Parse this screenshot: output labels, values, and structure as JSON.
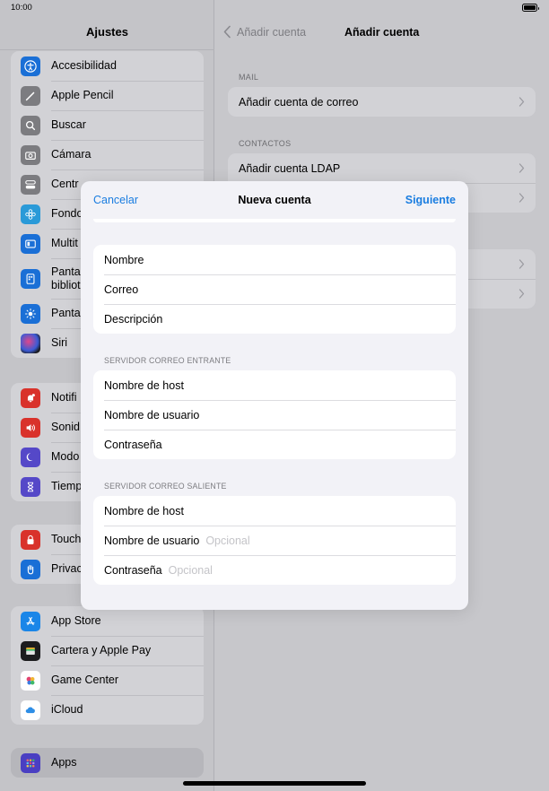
{
  "status": {
    "time": "10:00"
  },
  "sidebar": {
    "title": "Ajustes",
    "groups": [
      {
        "items": [
          {
            "label": "Accesibilidad",
            "icon": "accessibility-icon",
            "color": "#1a6fd6"
          },
          {
            "label": "Apple Pencil",
            "icon": "pencil-icon",
            "color": "#7c7c80"
          },
          {
            "label": "Buscar",
            "icon": "search-icon",
            "color": "#7c7c80"
          },
          {
            "label": "Cámara",
            "icon": "camera-icon",
            "color": "#7c7c80"
          },
          {
            "label": "Centr",
            "icon": "control-center-icon",
            "color": "#7c7c80"
          },
          {
            "label": "Fondo",
            "icon": "wallpaper-icon",
            "color": "#2a9ad8"
          },
          {
            "label": "Multit",
            "icon": "multitasking-icon",
            "color": "#1a6fd6"
          },
          {
            "label": "Panta\nbibliot",
            "icon": "home-screen-icon",
            "color": "#1a6fd6"
          },
          {
            "label": "Panta",
            "icon": "brightness-icon",
            "color": "#1a6fd6"
          },
          {
            "label": "Siri",
            "icon": "siri-icon",
            "color": "#222222"
          }
        ]
      },
      {
        "items": [
          {
            "label": "Notifi",
            "icon": "notifications-icon",
            "color": "#d9322b"
          },
          {
            "label": "Sonid",
            "icon": "sound-icon",
            "color": "#d9322b"
          },
          {
            "label": "Modo",
            "icon": "focus-moon-icon",
            "color": "#5548c8"
          },
          {
            "label": "Tiemp",
            "icon": "screen-time-icon",
            "color": "#5548c8"
          }
        ]
      },
      {
        "items": [
          {
            "label": "Touch",
            "icon": "lock-icon",
            "color": "#d9322b"
          },
          {
            "label": "Privac",
            "icon": "hand-icon",
            "color": "#1a6fd6"
          }
        ]
      },
      {
        "items": [
          {
            "label": "App Store",
            "icon": "app-store-icon",
            "color": "#1a86e8"
          },
          {
            "label": "Cartera y Apple Pay",
            "icon": "wallet-icon",
            "color": "#1c1c1e"
          },
          {
            "label": "Game Center",
            "icon": "game-center-icon",
            "color": "#ffffff"
          },
          {
            "label": "iCloud",
            "icon": "icloud-icon",
            "color": "#ffffff"
          }
        ]
      },
      {
        "items": [
          {
            "label": "Apps",
            "icon": "apps-grid-icon",
            "color": "#4a3fc2"
          }
        ]
      }
    ]
  },
  "detail": {
    "back_label": "Añadir cuenta",
    "title": "Añadir cuenta",
    "sections": [
      {
        "header": "MAIL",
        "rows": [
          "Añadir cuenta de correo"
        ]
      },
      {
        "header": "CONTACTOS",
        "rows": [
          "Añadir cuenta LDAP",
          ""
        ]
      },
      {
        "header": "",
        "rows": [
          "",
          ""
        ]
      }
    ]
  },
  "modal": {
    "cancel_label": "Cancelar",
    "title": "Nueva cuenta",
    "next_label": "Siguiente",
    "account_fields": [
      "Nombre",
      "Correo",
      "Descripción"
    ],
    "incoming": {
      "header": "SERVIDOR CORREO ENTRANTE",
      "fields": [
        "Nombre de host",
        "Nombre de usuario",
        "Contraseña"
      ]
    },
    "outgoing": {
      "header": "SERVIDOR CORREO SALIENTE",
      "fields": [
        "Nombre de host",
        "Nombre de usuario",
        "Contraseña"
      ],
      "username_placeholder": "Opcional",
      "password_placeholder": "Opcional"
    }
  },
  "colors": {
    "accent": "#1a7de0"
  }
}
